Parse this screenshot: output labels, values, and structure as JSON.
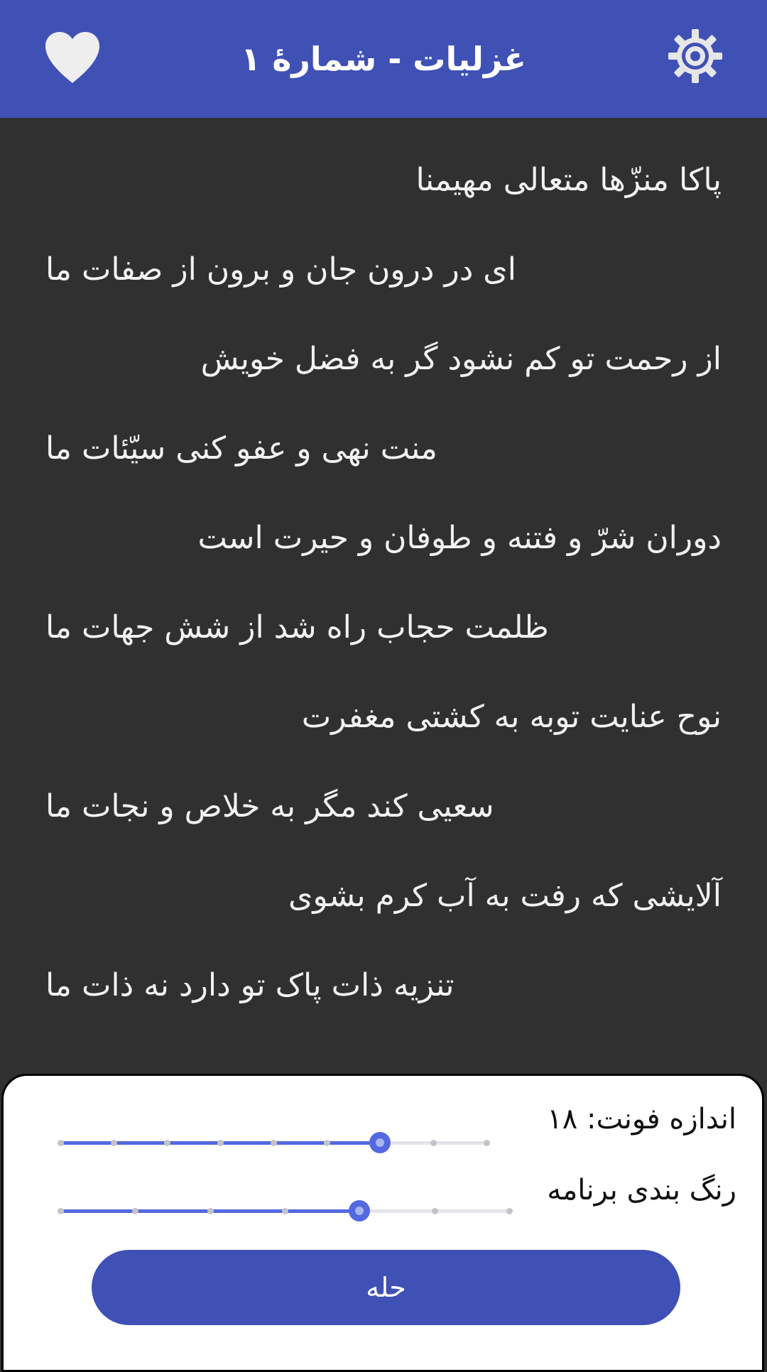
{
  "appbar": {
    "title": "غزلیات - شمارهٔ ۱",
    "favorite_icon": "heart-icon",
    "settings_icon": "gear-icon",
    "color": "#3f51b5"
  },
  "poem": {
    "verses": [
      "پاکا منزّها متعالی مهیمنا",
      "ای در درون جان و برون از صفات ما",
      "از رحمت تو کم نشود گر به فضل خویش",
      "منت نهی و عفو کنی سیّئات ما",
      "دوران شرّ و فتنه و طوفان و حیرت است",
      "ظلمت حجاب راه شد از شش جهات ما",
      "نوح عنایت توبه به کشتی مغفرت",
      "سعیی کند مگر به خلاص و نجات ما",
      "آلایشی که رفت به آب کرم بشوی",
      "تنزیه ذات پاک تو دارد نه ذات ما"
    ]
  },
  "settings_sheet": {
    "font_size_label": "اندازه فونت: ۱۸",
    "font_size_slider": {
      "steps": 9,
      "selected_index": 6
    },
    "theme_label": "رنگ بندی برنامه",
    "theme_slider": {
      "steps": 7,
      "selected_index": 4
    },
    "confirm_label": "حله",
    "accent_color": "#5468df"
  }
}
